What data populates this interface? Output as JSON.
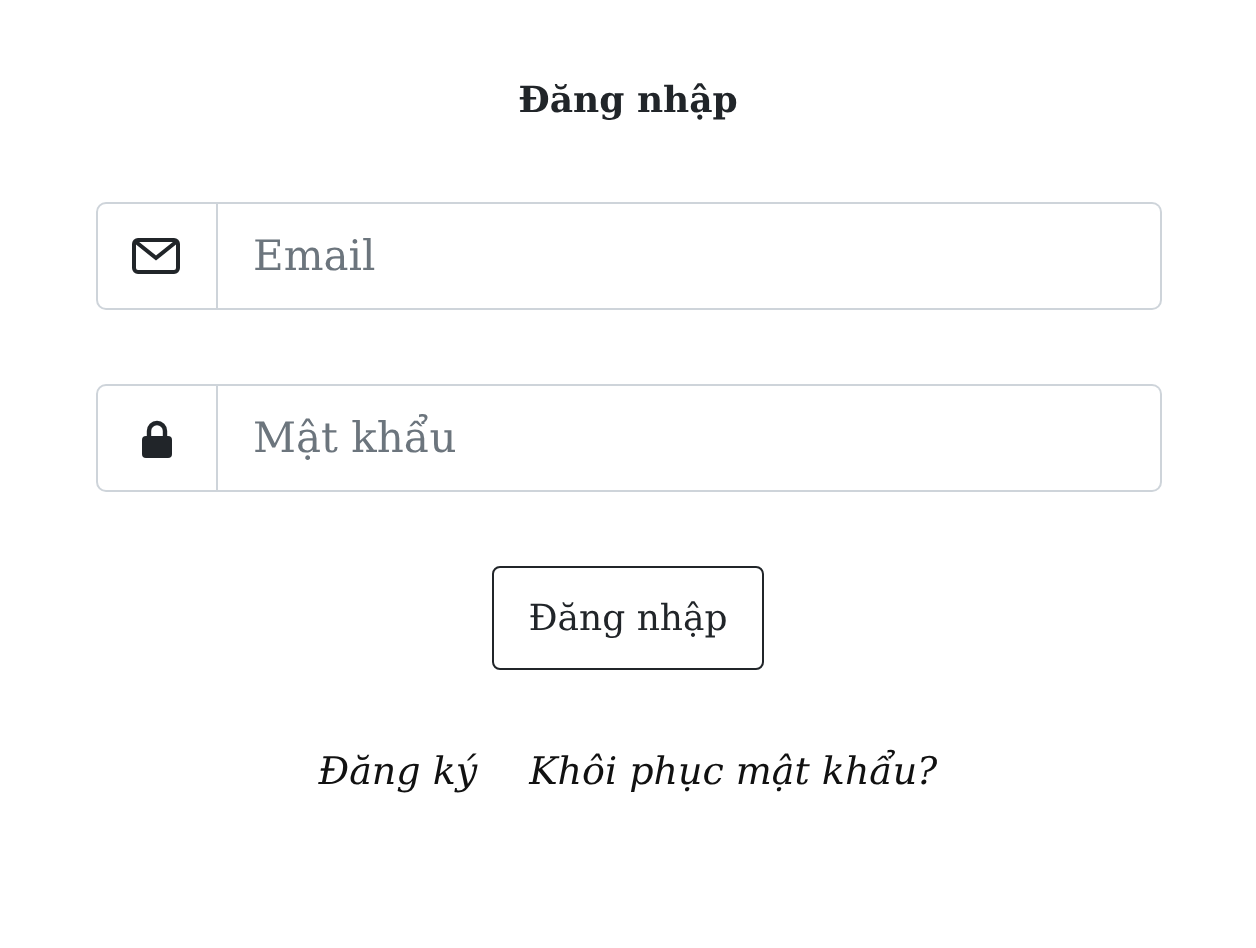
{
  "title": "Đăng nhập",
  "fields": [
    {
      "kind": "email",
      "placeholder": "Email"
    },
    {
      "kind": "password",
      "placeholder": "Mật khẩu"
    }
  ],
  "submit": "Đăng nhập",
  "links": [
    "Đăng ký",
    "Khôi phục mật khẩu?"
  ]
}
